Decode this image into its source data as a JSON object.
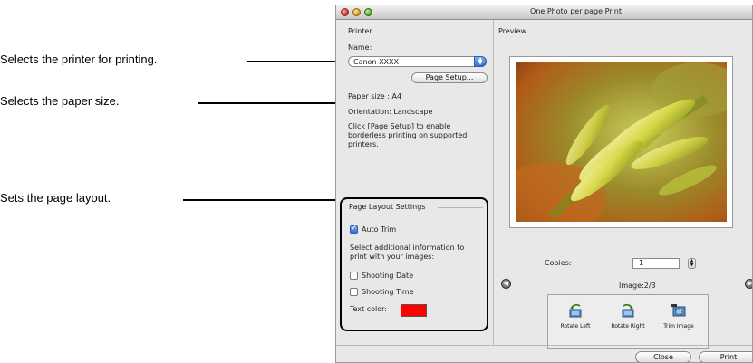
{
  "callouts": [
    {
      "text": "Selects the printer for printing."
    },
    {
      "text": "Selects the paper size."
    },
    {
      "text": "Sets the page layout."
    }
  ],
  "window": {
    "title": "One Photo per page Print"
  },
  "printer": {
    "section_label": "Printer",
    "name_label": "Name:",
    "selected_printer": "Canon XXXX",
    "page_setup_label": "Page Setup...",
    "paper_size": "Paper size : A4",
    "orientation": "Orientation: Landscape",
    "note_line1": "Click [Page Setup] to enable",
    "note_line2": "borderless printing on supported",
    "note_line3": "printers."
  },
  "layout": {
    "group_label": "Page Layout Settings",
    "auto_trim_label": "Auto Trim",
    "auto_trim_checked": true,
    "info_line1": "Select additional information to",
    "info_line2": "print with your images:",
    "shooting_date_label": "Shooting Date",
    "shooting_date_checked": false,
    "shooting_time_label": "Shooting Time",
    "shooting_time_checked": false,
    "text_color_label": "Text color:",
    "text_color": "#ff0000"
  },
  "preview": {
    "label": "Preview",
    "copies_label": "Copies:",
    "copies_value": "1",
    "image_counter": "Image:2/3"
  },
  "tools": [
    {
      "label": "Rotate Left",
      "icon": "rotate-left-icon"
    },
    {
      "label": "Rotate Right",
      "icon": "rotate-right-icon"
    },
    {
      "label": "Trim Image",
      "icon": "trim-image-icon"
    }
  ],
  "actions": {
    "close_label": "Close",
    "print_label": "Print"
  }
}
